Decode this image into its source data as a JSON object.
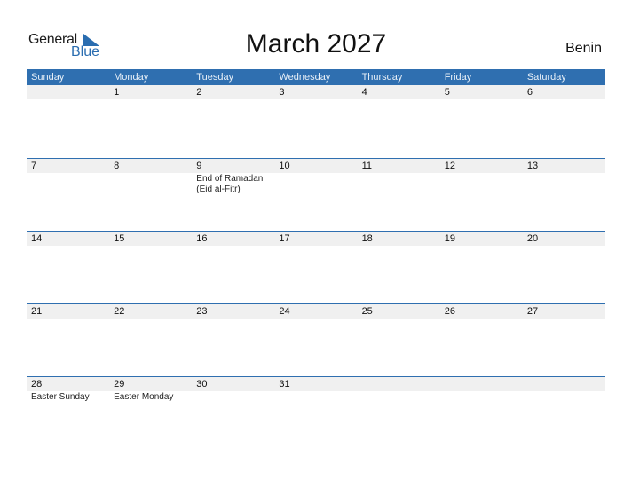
{
  "logo": {
    "line1": "General",
    "line2": "Blue"
  },
  "title": "March 2027",
  "country": "Benin",
  "colors": {
    "header_bg": "#2f6fb0",
    "day_row_bg": "#f0f0f0",
    "brand": "#2a6db0"
  },
  "weekdays": [
    "Sunday",
    "Monday",
    "Tuesday",
    "Wednesday",
    "Thursday",
    "Friday",
    "Saturday"
  ],
  "weeks": [
    {
      "days": [
        "",
        "1",
        "2",
        "3",
        "4",
        "5",
        "6"
      ],
      "events": [
        "",
        "",
        "",
        "",
        "",
        "",
        ""
      ]
    },
    {
      "days": [
        "7",
        "8",
        "9",
        "10",
        "11",
        "12",
        "13"
      ],
      "events": [
        "",
        "",
        "End of Ramadan (Eid al-Fitr)",
        "",
        "",
        "",
        ""
      ]
    },
    {
      "days": [
        "14",
        "15",
        "16",
        "17",
        "18",
        "19",
        "20"
      ],
      "events": [
        "",
        "",
        "",
        "",
        "",
        "",
        ""
      ]
    },
    {
      "days": [
        "21",
        "22",
        "23",
        "24",
        "25",
        "26",
        "27"
      ],
      "events": [
        "",
        "",
        "",
        "",
        "",
        "",
        ""
      ]
    },
    {
      "days": [
        "28",
        "29",
        "30",
        "31",
        "",
        "",
        ""
      ],
      "events": [
        "Easter Sunday",
        "Easter Monday",
        "",
        "",
        "",
        "",
        ""
      ]
    }
  ]
}
